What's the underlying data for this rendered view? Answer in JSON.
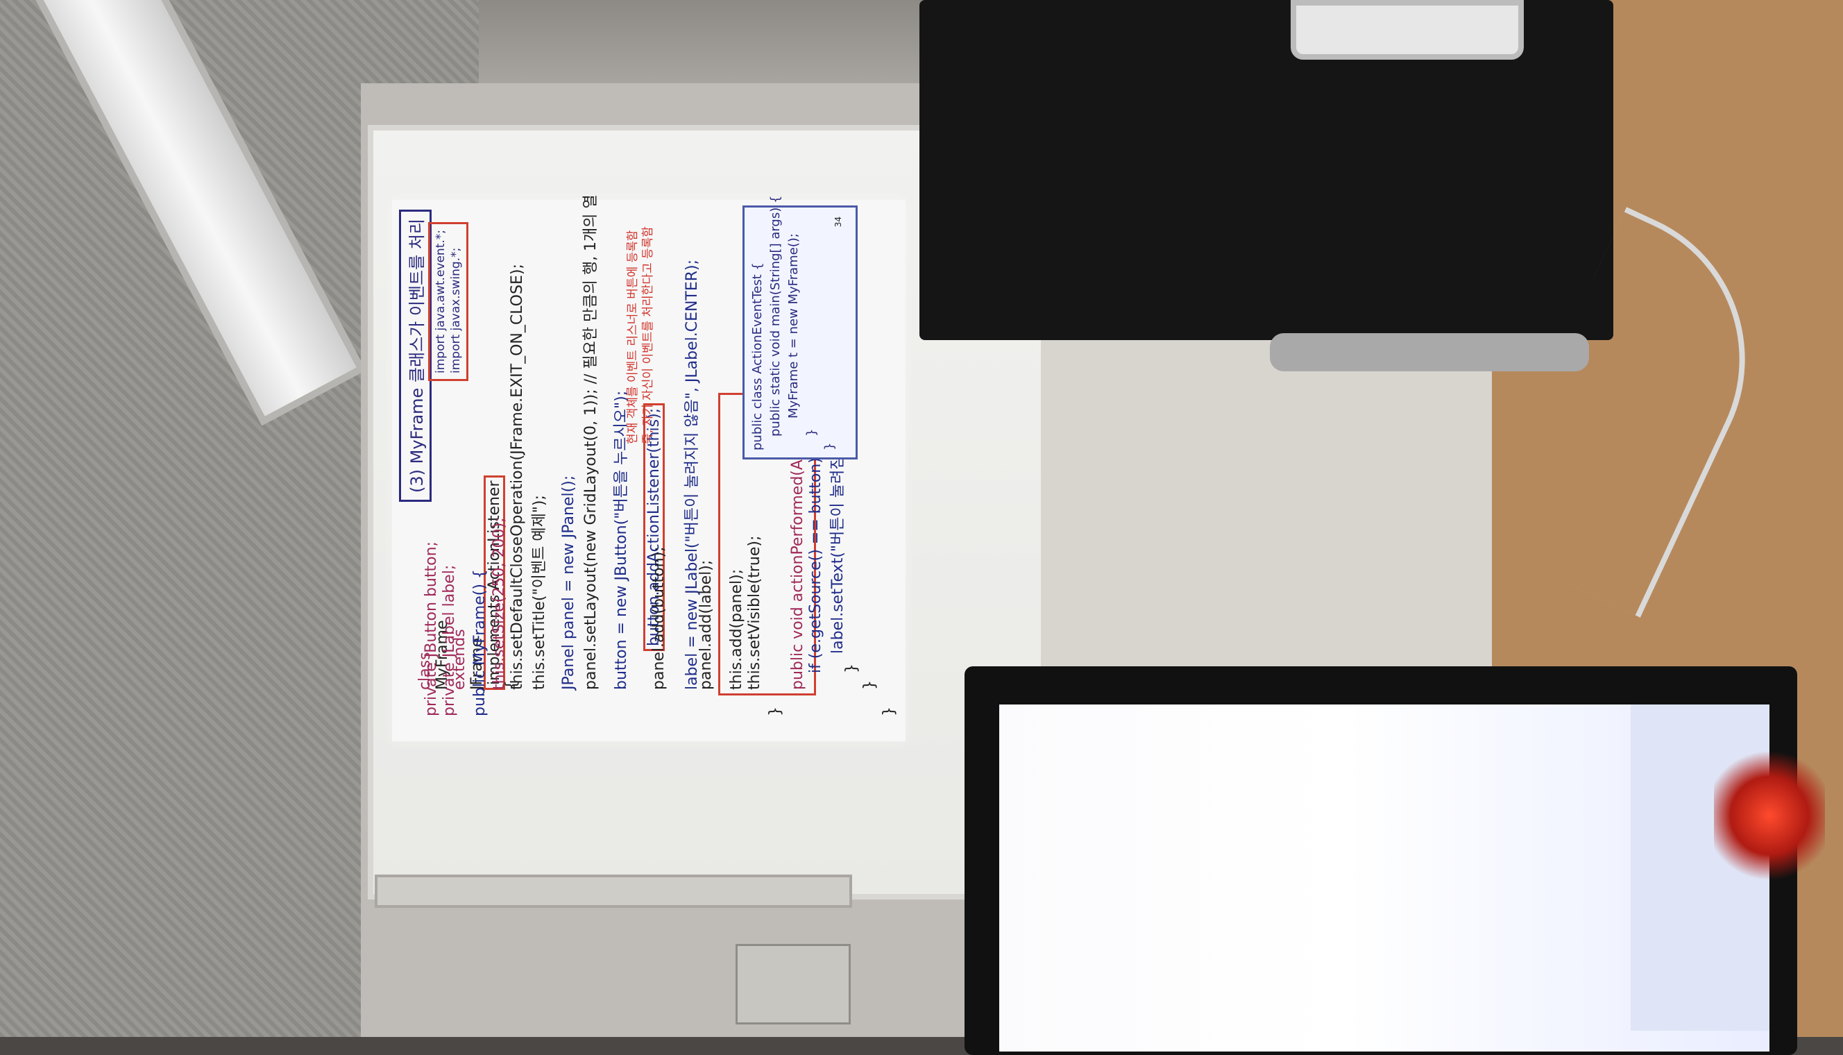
{
  "colors": {
    "keyword": "#a02a5a",
    "class": "#1f2d8a",
    "comment": "#1f9a3d",
    "annotation": "#d0342c"
  },
  "slide": {
    "title": "(3) MyFrame 클래스가 이벤트를 처리",
    "imports": [
      "import java.awt.event.*;",
      "import javax.swing.*;"
    ],
    "code": {
      "l1_class": "class",
      "l1_name": "MyFrame",
      "l1_extends": "extends",
      "l1_parent": "JFrame",
      "l1_impl": "implements ActionListener",
      "l1_end": "{",
      "l2": "private JButton button;",
      "l3": "private JLabel label;",
      "l4": "public MyFrame() {",
      "l5": "this.setSize(250, 200);",
      "l6": "this.setDefaultCloseOperation(JFrame.EXIT_ON_CLOSE);",
      "l7": "this.setTitle(\"이벤트 예제\");",
      "l8": "JPanel panel = new JPanel();",
      "l9": "panel.setLayout(new GridLayout(0, 1)); // 필요한 만큼의 행, 1개의 열",
      "l10": "button = new JButton(\"버튼을 누르시오\");",
      "l11_code": "button.addActionListener(this);",
      "l11_note1": "현재 객체를 이벤트 리스너로 버튼에 등록함",
      "l11_note2": "즉, 자기 자신이 이벤트를 처리한다고 등록함",
      "l12": "panel.add(button);",
      "l13": "label = new JLabel(\"버튼이 눌려지지 않음\", JLabel.CENTER);",
      "l14": "panel.add(label);",
      "l15": "this.add(panel);",
      "l16": "this.setVisible(true);",
      "l17": "}",
      "l18": "public void actionPerformed(ActionEvent e) {",
      "l19": "if (e.getSource() == button) {",
      "l20": "label.setText(\"버튼이 눌려짐\");",
      "l21": "}",
      "l22": "}",
      "l23": "}"
    },
    "main_box": {
      "r1": "public class ActionEventTest {",
      "r2": "public static void main(String[] args) {",
      "r3": "MyFrame t = new MyFrame();",
      "r4": "}",
      "r5": "}"
    },
    "page_number": "34"
  }
}
